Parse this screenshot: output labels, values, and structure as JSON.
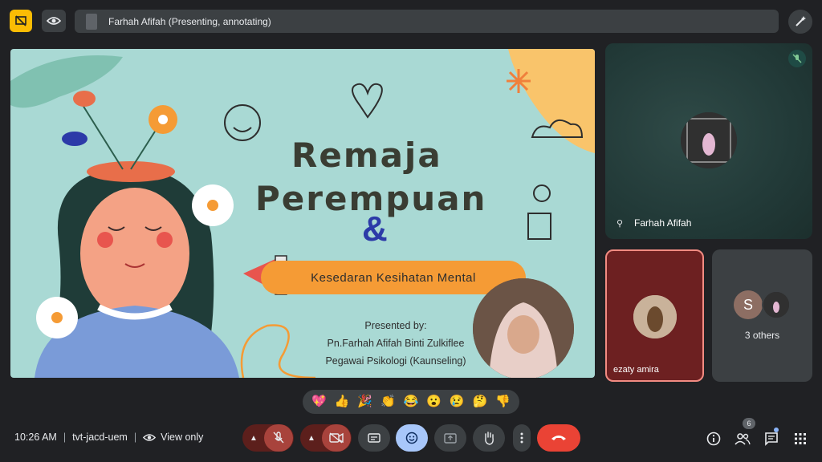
{
  "top_bar": {
    "presenting_text": "Farhah Afifah (Presenting, annotating)"
  },
  "slide": {
    "title_line1": "Remaja",
    "title_line2": "Perempuan",
    "ampersand": "&",
    "subtitle": "Kesedaran Kesihatan Mental",
    "presented_by": "Presented by:",
    "presenter_name": "Pn.Farhah Afifah Binti Zulkiflee",
    "presenter_role": "Pegawai Psikologi (Kaunseling)"
  },
  "tiles": {
    "main": {
      "name": "Farhah Afifah"
    },
    "ezaty": {
      "name": "ezaty amira"
    },
    "others": {
      "initial": "S",
      "label": "3 others"
    }
  },
  "reactions": [
    "💖",
    "👍",
    "🎉",
    "👏",
    "😂",
    "😮",
    "😢",
    "🤔",
    "👎"
  ],
  "bottom_bar": {
    "time": "10:26 AM",
    "meeting_code": "tvt-jacd-uem",
    "view_only": "View only",
    "people_count": "6"
  },
  "colors": {
    "background": "#202124",
    "slide_background": "#a9d9d4",
    "accent_orange": "#f59b35",
    "leave_red": "#ea4335",
    "emoji_active": "#a8c7fa"
  }
}
